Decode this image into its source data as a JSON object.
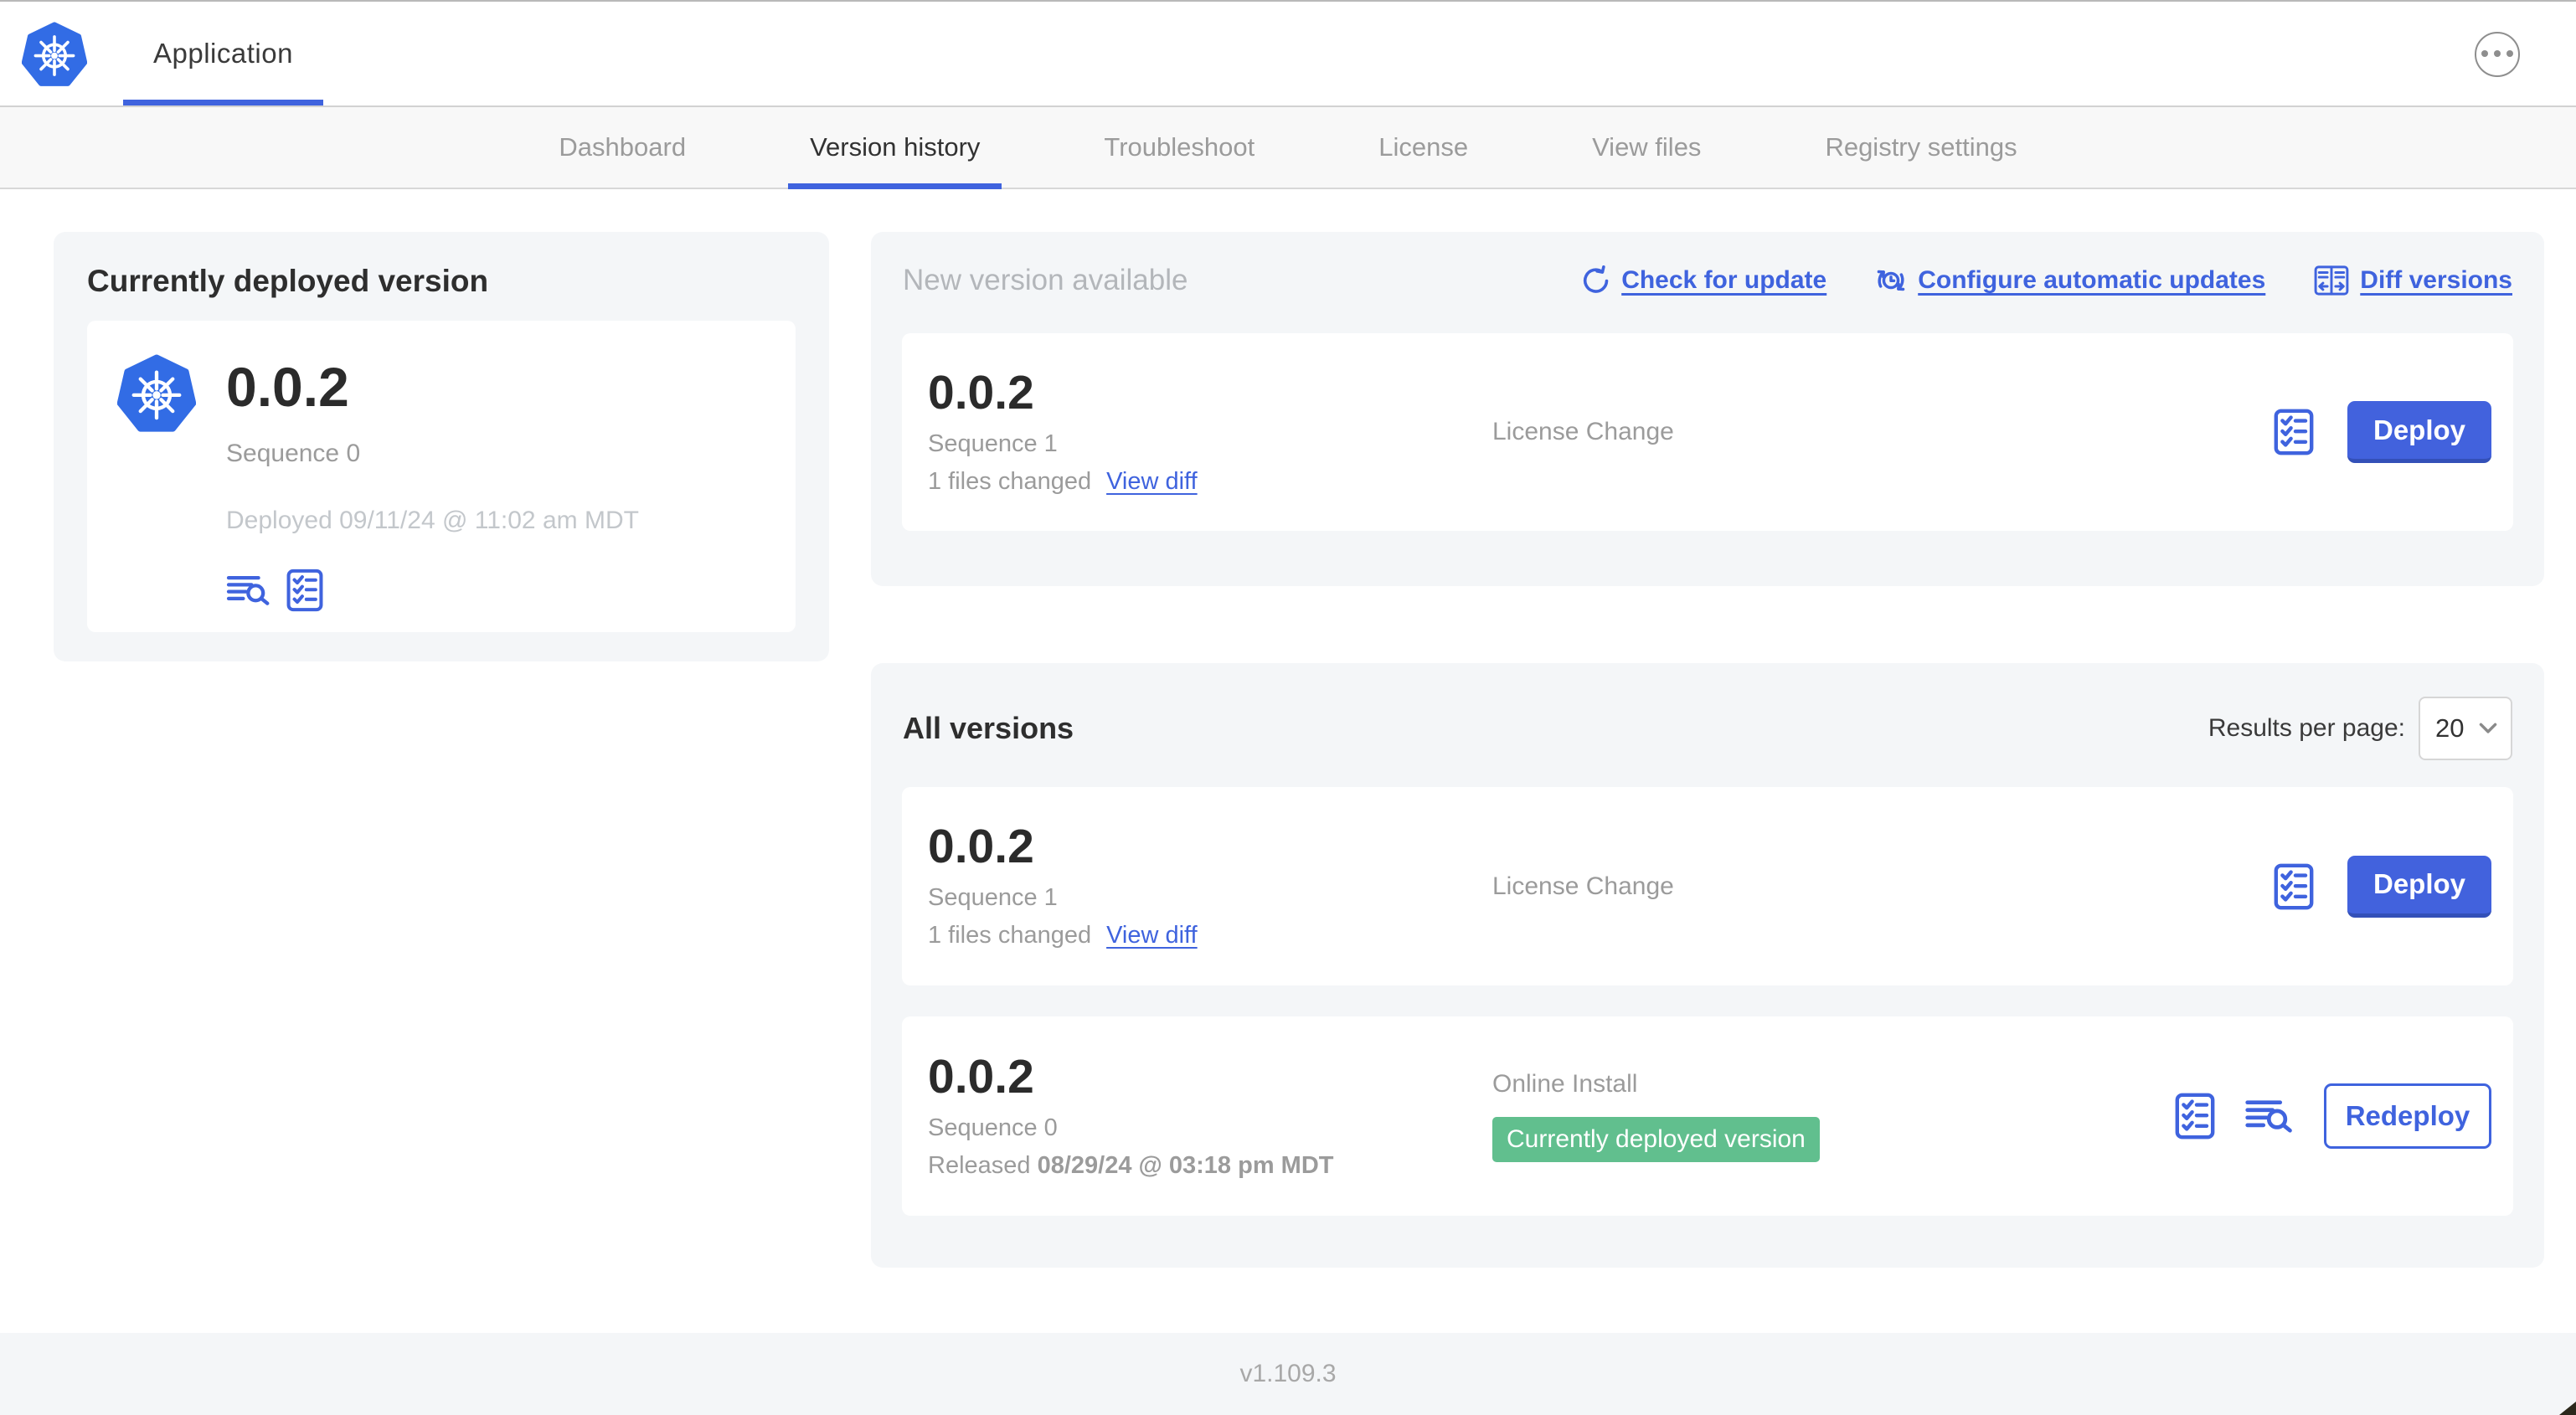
{
  "header": {
    "app_tab_label": "Application"
  },
  "nav": {
    "active_tab": "Version history",
    "tabs": [
      {
        "label": "Dashboard"
      },
      {
        "label": "Version history"
      },
      {
        "label": "Troubleshoot"
      },
      {
        "label": "License"
      },
      {
        "label": "View files"
      },
      {
        "label": "Registry settings"
      }
    ]
  },
  "current_version_card": {
    "title": "Currently deployed version",
    "version": "0.0.2",
    "sequence": "Sequence 0",
    "deployed": "Deployed 09/11/24 @ 11:02 am MDT"
  },
  "new_version_section": {
    "title": "New version available",
    "links": {
      "check_for_update": "Check for update",
      "configure_automatic_updates": "Configure automatic updates",
      "diff_versions": "Diff versions"
    },
    "row": {
      "version": "0.0.2",
      "sequence": "Sequence 1",
      "files_changed": "1 files changed",
      "view_diff": "View diff",
      "source": "License Change",
      "action": "Deploy"
    }
  },
  "all_versions_section": {
    "title": "All versions",
    "results_per_page_label": "Results per page:",
    "results_per_page_value": "20",
    "rows": [
      {
        "version": "0.0.2",
        "sequence": "Sequence 1",
        "files_changed": "1 files changed",
        "view_diff": "View diff",
        "source": "License Change",
        "action": "Deploy"
      },
      {
        "version": "0.0.2",
        "sequence": "Sequence 0",
        "released_label": "Released ",
        "released_date": "08/29/24 @ 03:18 pm MDT",
        "source": "Online Install",
        "badge": "Currently deployed version",
        "action": "Redeploy"
      }
    ]
  },
  "footer": {
    "console_version": "v1.109.3"
  },
  "colors": {
    "accent_blue": "#3f63de",
    "button_blue": "#4262dd",
    "button_blue_shadow": "#3350b8",
    "kubernetes_blue": "#326ce5",
    "badge_green": "#61bf8e",
    "muted_text": "#9b9b9b",
    "card_background": "#f4f6f8"
  }
}
